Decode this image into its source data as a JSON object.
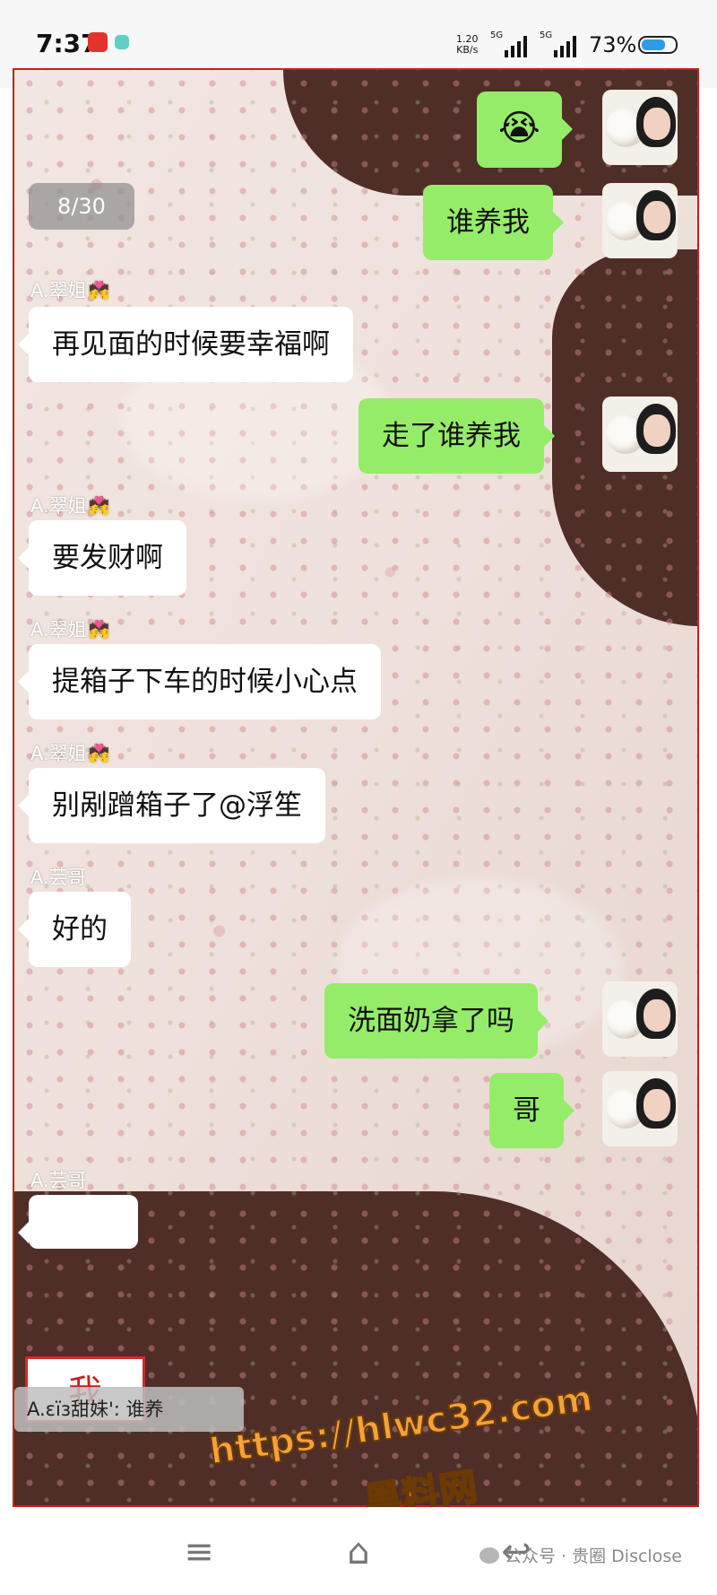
{
  "status_bar": {
    "time": "7:37",
    "net_speed_value": "1.20",
    "net_speed_unit": "KB/s",
    "sim1_label": "5G",
    "sim2_label": "5G",
    "battery_percent": "73%",
    "battery_level": 0.73
  },
  "chat": {
    "counter": "8/30",
    "messages": [
      {
        "side": "right",
        "type": "emoji",
        "text": "😭"
      },
      {
        "side": "right",
        "text": "谁养我"
      },
      {
        "side": "left",
        "sender": "A.翠姐",
        "sender_emoji": "💏",
        "text": "再见面的时候要幸福啊"
      },
      {
        "side": "right",
        "text": "走了谁养我"
      },
      {
        "side": "left",
        "sender": "A.翠姐",
        "sender_emoji": "💏",
        "text": "要发财啊"
      },
      {
        "side": "left",
        "sender": "A.翠姐",
        "sender_emoji": "💏",
        "text": "提箱子下车的时候小心点"
      },
      {
        "side": "left",
        "sender": "A.翠姐",
        "sender_emoji": "💏",
        "text": "别剐蹭箱子了@浮笙"
      },
      {
        "side": "left",
        "sender": "A.芸哥",
        "text": "好的"
      },
      {
        "side": "right",
        "text": "洗面奶拿了吗"
      },
      {
        "side": "right",
        "text": "哥"
      },
      {
        "side": "left",
        "sender": "A.芸哥",
        "text": ""
      }
    ],
    "me_label": "我",
    "reply_preview": "A.ɛïɜ甜妹':  谁养"
  },
  "watermark": {
    "line1": "https://hlwc32.com",
    "line2": "黑料网"
  },
  "nav_bar": {
    "menu_icon": "≡",
    "home_icon": "⌂",
    "back_icon": "↩",
    "account_label": "公众号 · 贵圈 Disclose"
  }
}
